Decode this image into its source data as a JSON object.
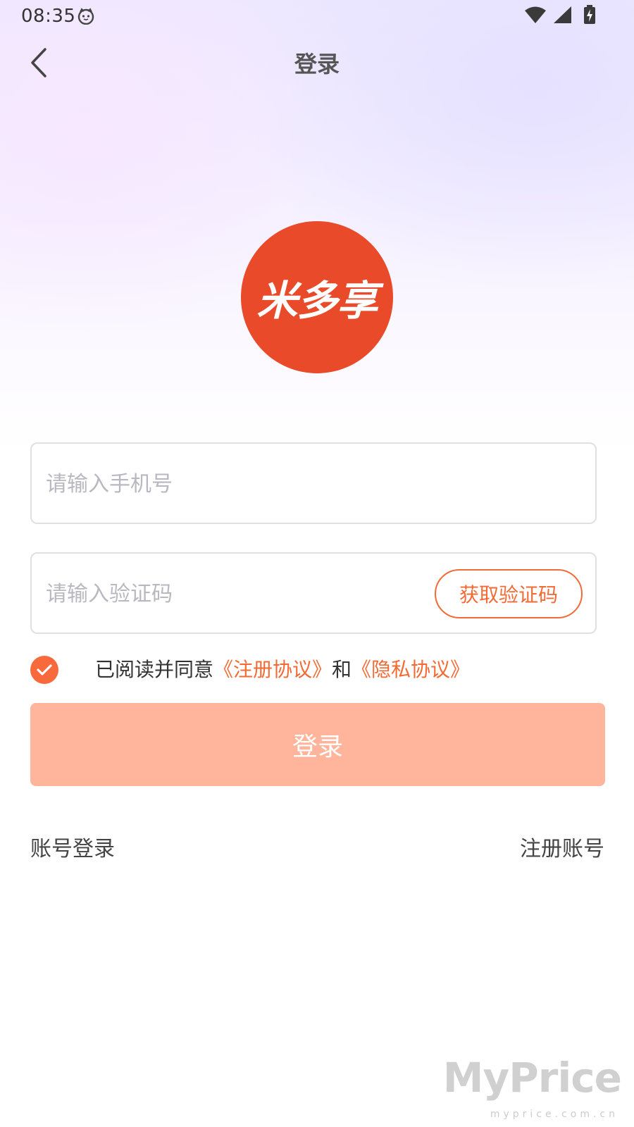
{
  "status_bar": {
    "time": "08:35",
    "icons": [
      "cat-face-icon",
      "wifi-icon",
      "cellular-signal-icon",
      "battery-charging-icon"
    ]
  },
  "header": {
    "title": "登录",
    "back_icon": "chevron-left-icon"
  },
  "logo": {
    "text": "米多享",
    "color": "#e84a2a"
  },
  "form": {
    "phone_value": "",
    "phone_placeholder": "请输入手机号",
    "code_value": "",
    "code_placeholder": "请输入验证码",
    "get_code_label": "获取验证码"
  },
  "agreement": {
    "checked": true,
    "prefix": "已阅读并同意",
    "link_register": "《注册协议》",
    "conjunction": "和",
    "link_privacy": "《隐私协议》"
  },
  "login_button": {
    "label": "登录",
    "color": "#ffb59c"
  },
  "bottom_links": {
    "account_login": "账号登录",
    "register": "注册账号"
  },
  "colors": {
    "accent": "#f26a34",
    "checkbox": "#f86a3c"
  },
  "watermark": {
    "main": "MyPrice",
    "sub": "myprice.com.cn"
  }
}
